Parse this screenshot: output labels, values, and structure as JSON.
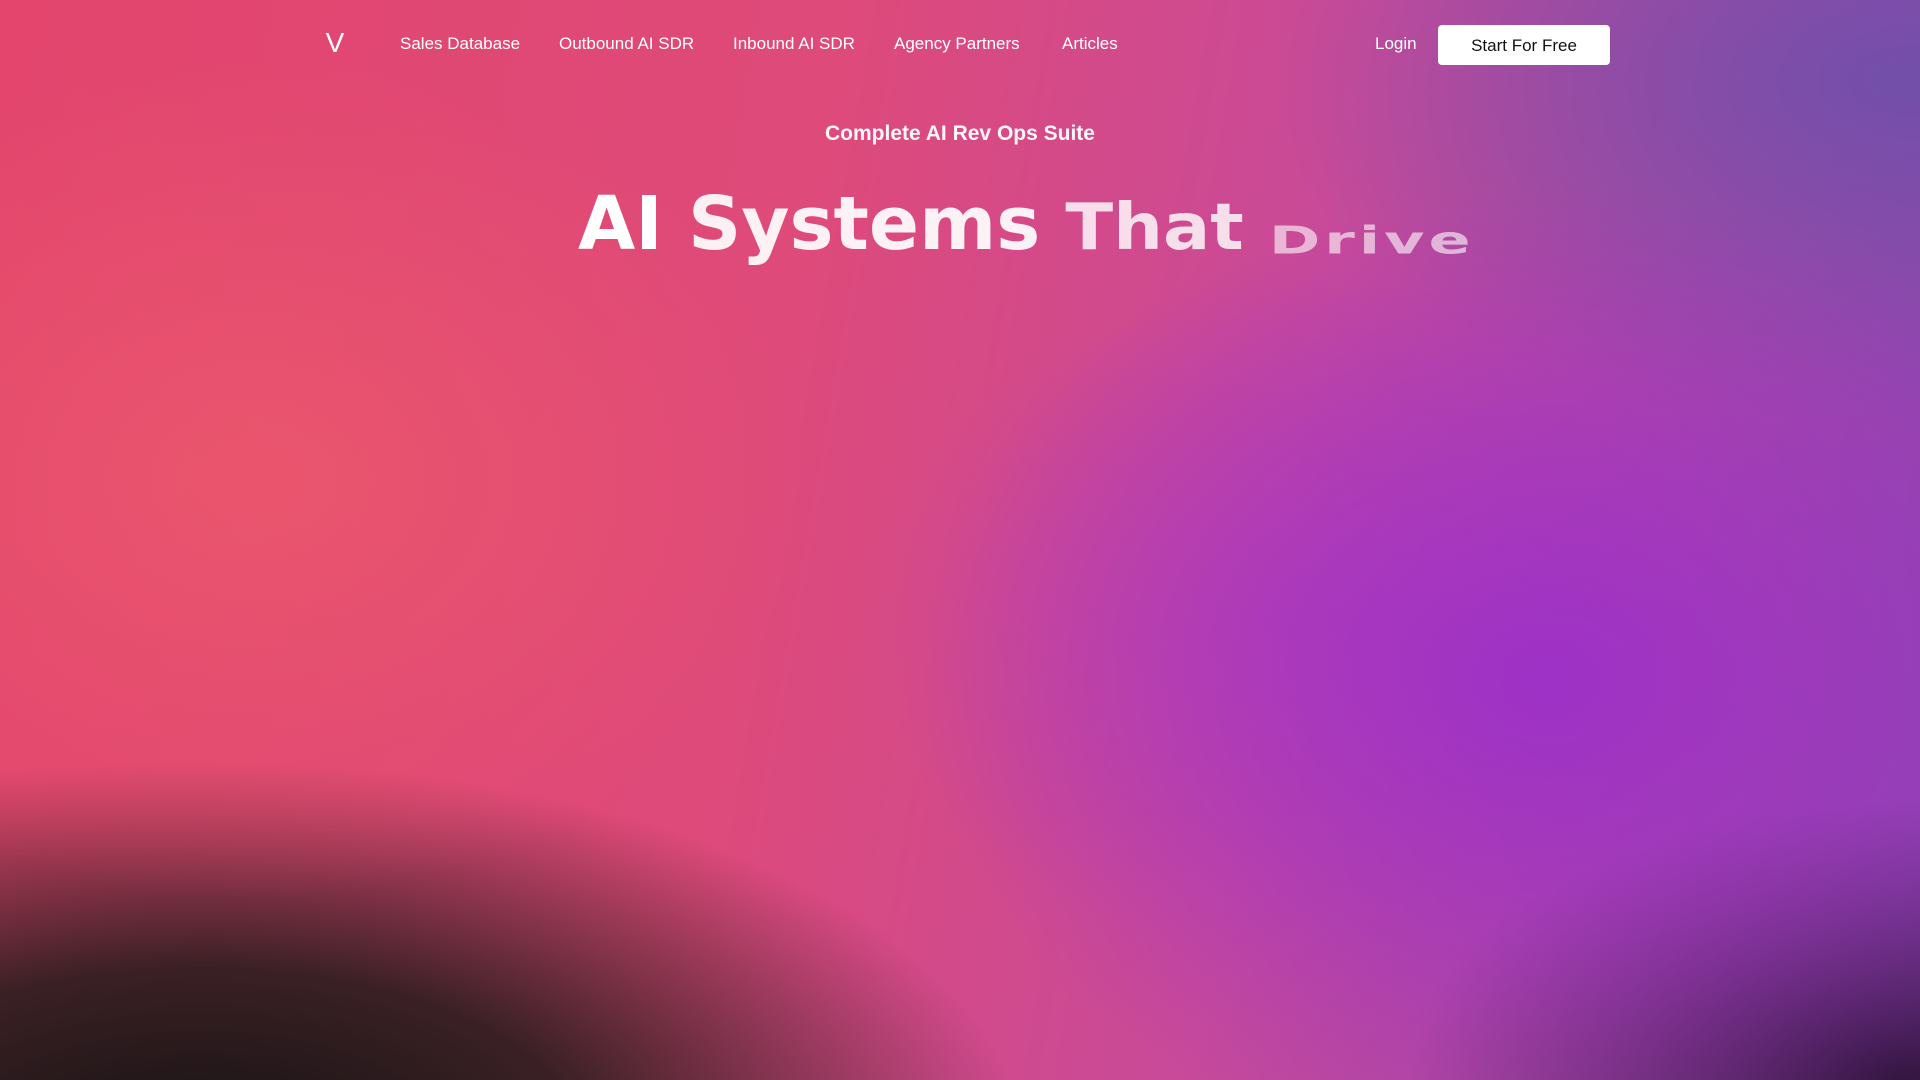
{
  "nav": {
    "logo_text": "V",
    "links": [
      "Sales Database",
      "Outbound AI SDR",
      "Inbound AI SDR",
      "Agency Partners",
      "Articles"
    ],
    "login_label": "Login",
    "cta_label": "Start For Free"
  },
  "hero": {
    "eyebrow": "Complete AI Rev Ops Suite",
    "headline_words": [
      "AI",
      "Systems",
      "That",
      "Drive"
    ]
  },
  "colors": {
    "primary_pink": "#e3456c",
    "purple": "#9c30c8",
    "button_bg": "#ffffff",
    "button_text": "#111111"
  }
}
